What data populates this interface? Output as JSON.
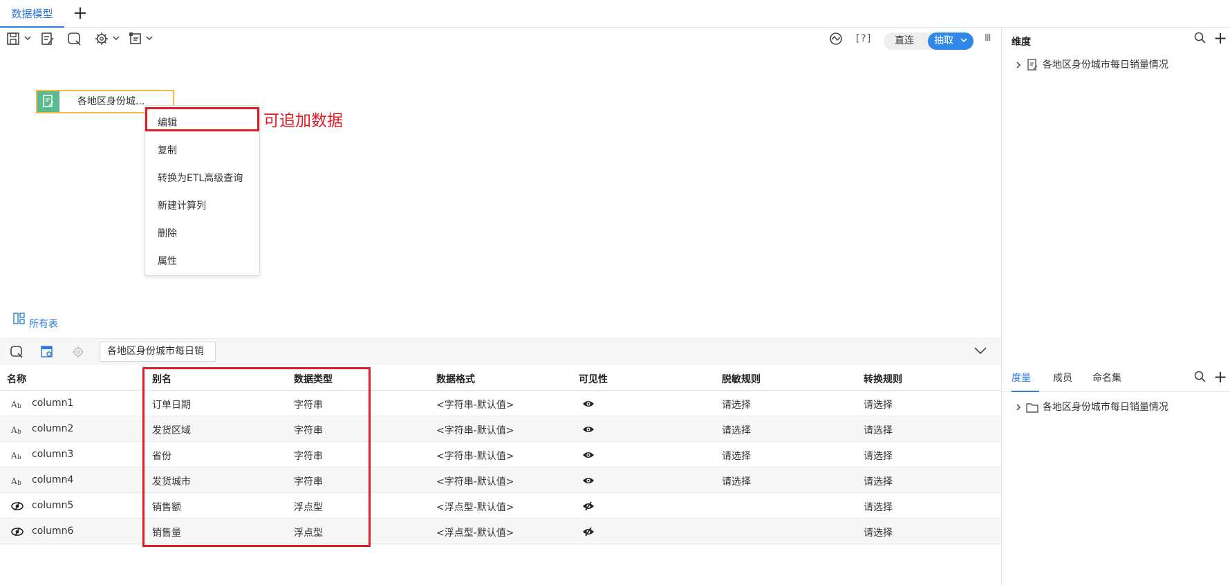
{
  "tabs": {
    "active": "数据模型",
    "add_label": "+"
  },
  "toolbar": {
    "help_label": "[?]",
    "mode_direct": "直连",
    "mode_extract": "抽取",
    "column_toggle": "III"
  },
  "canvas": {
    "node_label": "各地区身份城..."
  },
  "context_menu": {
    "items": [
      "编辑",
      "复制",
      "转换为ETL高级查询",
      "新建计算列",
      "删除",
      "属性"
    ]
  },
  "annotation": "可追加数据",
  "all_tables": "所有表",
  "bottom": {
    "table_select": "各地区身份城市每日销"
  },
  "grid": {
    "headers": [
      "名称",
      "别名",
      "数据类型",
      "数据格式",
      "可见性",
      "脱敏规则",
      "转换规则"
    ],
    "rows": [
      {
        "icon": "text-type-icon",
        "name": "column1",
        "alias": "订单日期",
        "type": "字符串",
        "format": "<字符串-默认值>",
        "masking": "请选择",
        "convert": "请选择"
      },
      {
        "icon": "text-type-icon",
        "name": "column2",
        "alias": "发货区域",
        "type": "字符串",
        "format": "<字符串-默认值>",
        "masking": "请选择",
        "convert": "请选择"
      },
      {
        "icon": "text-type-icon",
        "name": "column3",
        "alias": "省份",
        "type": "字符串",
        "format": "<字符串-默认值>",
        "masking": "请选择",
        "convert": "请选择"
      },
      {
        "icon": "text-type-icon",
        "name": "column4",
        "alias": "发货城市",
        "type": "字符串",
        "format": "<字符串-默认值>",
        "masking": "请选择",
        "convert": "请选择"
      },
      {
        "icon": "numeric-type-icon",
        "name": "column5",
        "alias": "销售额",
        "type": "浮点型",
        "format": "<浮点型-默认值>",
        "masking": "",
        "convert": "请选择"
      },
      {
        "icon": "numeric-type-icon",
        "name": "column6",
        "alias": "销售量",
        "type": "浮点型",
        "format": "<浮点型-默认值>",
        "masking": "",
        "convert": "请选择"
      }
    ]
  },
  "right_panel": {
    "dimension_title": "维度",
    "dimension_item": "各地区身份城市每日销量情况",
    "tabs": [
      "度量",
      "成员",
      "命名集"
    ],
    "measure_item": "各地区身份城市每日销量情况",
    "add_label": "+"
  },
  "colors": {
    "accent": "#2f7bd9",
    "highlight": "#e01c24",
    "node_icon": "#5bb98f",
    "node_border": "#f5b84a"
  }
}
